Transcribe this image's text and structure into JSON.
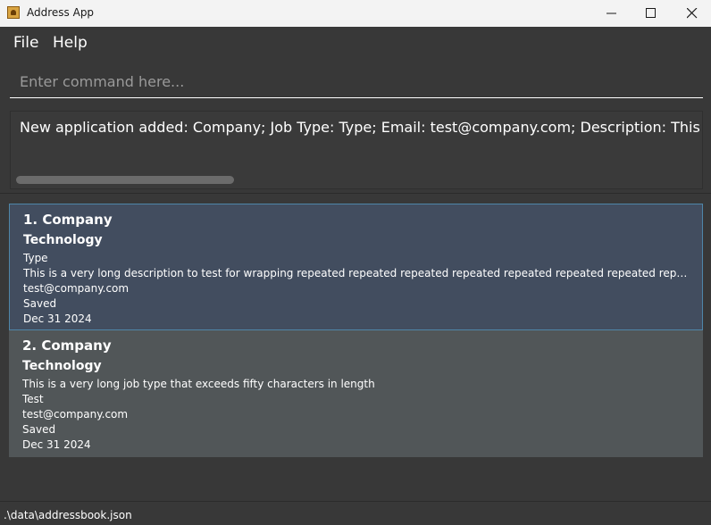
{
  "window": {
    "title": "Address App",
    "icon": "address-book-app-icon"
  },
  "menu": {
    "file": "File",
    "help": "Help"
  },
  "command": {
    "placeholder": "Enter command here...",
    "value": ""
  },
  "result": {
    "text": "New application added: Company; Job Type: Type; Email: test@company.com; Description: This is a very long description to test for wrapping repeated repeated repeated"
  },
  "applications": [
    {
      "index_name": "1.  Company",
      "industry": "Technology",
      "job_type": "Type",
      "description": "This is a very long description to test for wrapping repeated repeated repeated repeated repeated repeated repeated repeated re...",
      "email": "test@company.com",
      "status": "Saved",
      "date": "Dec 31 2024"
    },
    {
      "index_name": "2.  Company",
      "industry": "Technology",
      "job_type": "This is a very long job type that exceeds fifty characters in length",
      "description": "Test",
      "email": "test@company.com",
      "status": "Saved",
      "date": "Dec 31 2024"
    }
  ],
  "status_bar": {
    "path": ".\\data\\addressbook.json"
  },
  "colors": {
    "background": "#383838",
    "selected_card": "#424d5f",
    "selected_border": "#4f86a8",
    "card": "#515658",
    "titlebar": "#f3f3f3"
  }
}
